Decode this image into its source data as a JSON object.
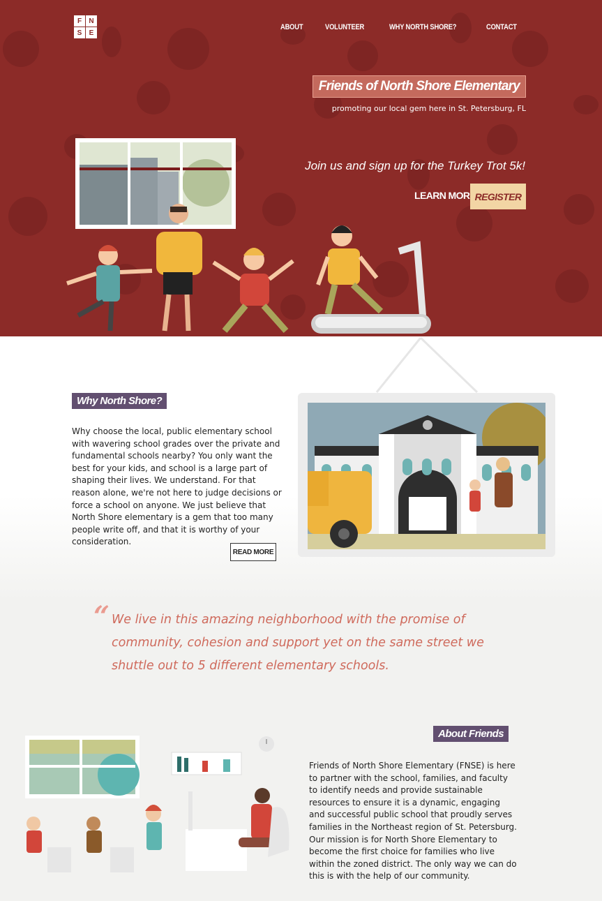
{
  "logo": {
    "letters": [
      "F",
      "N",
      "S",
      "E"
    ]
  },
  "nav": {
    "about": "ABOUT",
    "volunteer": "VOLUNTEER",
    "why": "WHY NORTH SHORE?",
    "contact": "CONTACT"
  },
  "hero": {
    "title": "Friends of North Shore Elementary",
    "subtitle": "promoting our local gem here in St. Petersburg, FL",
    "cta": "Join us and sign up for the Turkey Trot 5k!",
    "learn_more": "LEARN MORE",
    "register": "REGISTER"
  },
  "why": {
    "tag": "Why North Shore?",
    "text": "Why choose the local, public elementary school with wavering school grades over the private and fundamental schools nearby? You only want the best for your kids, and school is a large part of shaping their lives. We understand. For that reason alone, we're not here to judge decisions or force a school on anyone. We just believe that North Shore elementary is a gem that too many people write off, and that it is worthy of your consideration.",
    "read_more": "READ MORE"
  },
  "quote": {
    "text": "We live in this amazing neighborhood with the promise of community, cohesion and support yet on the same street we shuttle out to 5 different elementary schools."
  },
  "about": {
    "tag": "About Friends",
    "text": "Friends of North Shore Elementary (FNSE) is here to partner with the school, families, and faculty to identify needs and provide sustainable resources to ensure it is a dynamic, engaging and successful public school that proudly serves families in the Northeast region of St. Petersburg. Our mission is for North Shore Elementary to become the first choice for families who live within the zoned district. The only way we can do this is with the help of our community."
  },
  "colors": {
    "hero_bg": "#8c2b28",
    "accent_tag": "#624f70",
    "register_bg": "#f2d5a4",
    "quote": "#cf6a5c"
  },
  "icons": [
    "quote-mark-icon",
    "clock-icon"
  ]
}
